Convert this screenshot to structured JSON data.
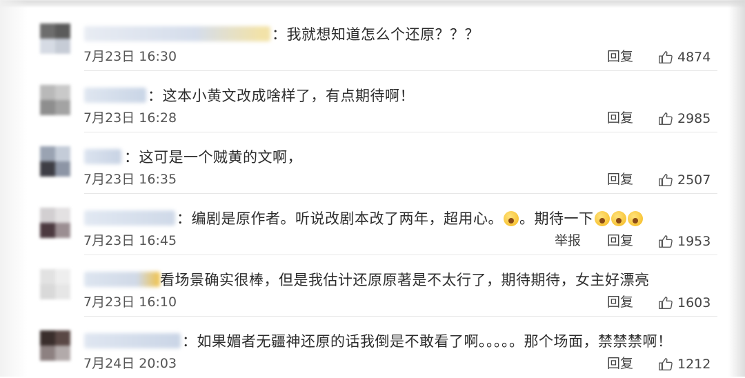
{
  "comments": [
    {
      "text": "：我就想知道怎么个还原？？？",
      "time": "7月23日 16:30",
      "actions": {
        "reply": "回复"
      },
      "likes": "4874"
    },
    {
      "text": "：这本小黄文改成啥样了，有点期待啊！",
      "time": "7月23日 16:28",
      "actions": {
        "reply": "回复"
      },
      "likes": "2985"
    },
    {
      "text": "：这可是一个贼黄的文啊，",
      "time": "7月23日 16:35",
      "actions": {
        "reply": "回复"
      },
      "likes": "2507"
    },
    {
      "text_main": "：编剧是原作者。听说改剧本改了两年，超用心。",
      "text_tail": "。期待一下",
      "time": "7月23日 16:45",
      "actions": {
        "report": "举报",
        "reply": "回复"
      },
      "likes": "1953"
    },
    {
      "text": "看场景确实很棒，但是我估计还原原著是不太行了，期待期待，女主好漂亮",
      "time": "7月23日 16:10",
      "actions": {
        "reply": "回复"
      },
      "likes": "1603"
    },
    {
      "text": "：如果媚者无疆神还原的话我倒是不敢看了啊。。。。。那个场面，禁禁禁啊！",
      "time": "7月24日 20:03",
      "actions": {
        "reply": "回复"
      },
      "likes": "1212"
    }
  ],
  "icons": {
    "like": "thumbs-up-icon",
    "emoji": "face-emoji-icon"
  }
}
